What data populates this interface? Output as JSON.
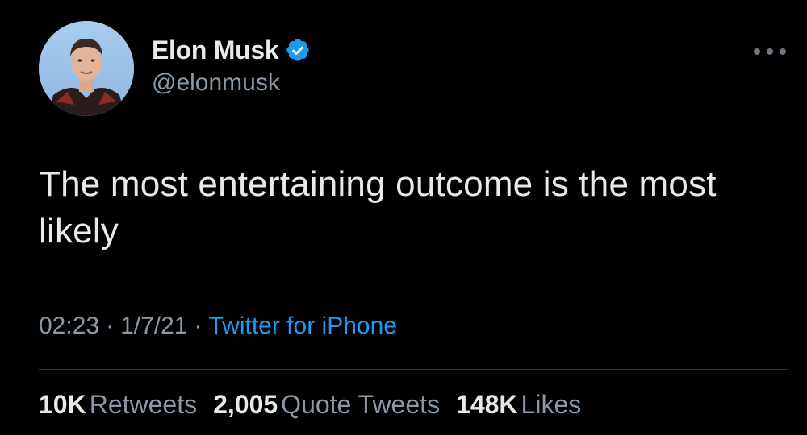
{
  "user": {
    "display_name": "Elon Musk",
    "handle": "@elonmusk",
    "verified": true,
    "verified_icon": "verified-badge-icon"
  },
  "tweet": {
    "text": "The most entertaining outcome is the most likely",
    "time": "02:23",
    "date": "1/7/21",
    "source": "Twitter for iPhone"
  },
  "stats": {
    "retweets_count": "10K",
    "retweets_label": "Retweets",
    "quotes_count": "2,005",
    "quotes_label": "Quote Tweets",
    "likes_count": "148K",
    "likes_label": "Likes"
  },
  "colors": {
    "background": "#000000",
    "text_primary": "#e7e9ea",
    "text_secondary": "#8b98a5",
    "link": "#1d9bf0",
    "verified": "#1d9bf0",
    "divider": "#2f3336"
  }
}
